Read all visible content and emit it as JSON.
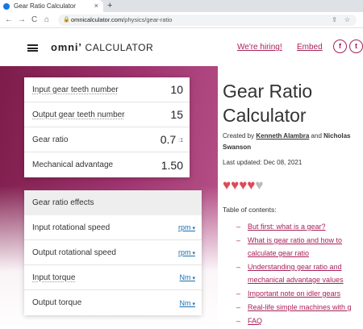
{
  "browser": {
    "tab_title": "Gear Ratio Calculator",
    "tab_close": "×",
    "new_tab": "+",
    "back": "←",
    "forward": "→",
    "reload": "C",
    "home": "⌂",
    "url_host": "omnicalculator.com",
    "url_path": "/physics/gear-ratio"
  },
  "header": {
    "logo_omni": "omni",
    "logo_calc": "CALCULATOR",
    "hiring": "We're hiring!",
    "embed": "Embed",
    "facebook": "f",
    "twitter": "t"
  },
  "calculator": {
    "rows": [
      {
        "label": "Input gear teeth number",
        "value": "10"
      },
      {
        "label": "Output gear teeth number",
        "value": "15"
      },
      {
        "label": "Gear ratio",
        "value": "0.7",
        "unit": ":1"
      },
      {
        "label": "Mechanical advantage",
        "value": "1.50"
      }
    ],
    "section_title": "Gear ratio effects",
    "effects": [
      {
        "label": "Input rotational speed",
        "unit": "rpm"
      },
      {
        "label": "Output rotational speed",
        "unit": "rpm"
      },
      {
        "label": "Input torque",
        "unit": "Nm"
      },
      {
        "label": "Output torque",
        "unit": "Nm"
      }
    ]
  },
  "article": {
    "title": "Gear Ratio Calculator",
    "created_by": "Created by",
    "author1": "Kenneth Alambra",
    "and": "and",
    "author2": "Nicholas Swanson",
    "updated": "Last updated: Dec 08, 2021",
    "rating": 4.5,
    "toc_title": "Table of contents:",
    "toc": [
      "But first: what is a gear?",
      "What is gear ratio and how to calculate gear ratio",
      "Understanding gear ratio and mechanical advantage values",
      "Important note on idler gears",
      "Real-life simple machines with g",
      "FAQ"
    ]
  },
  "colors": {
    "brand": "#a8215a",
    "link_blue": "#1a6fb0",
    "heart": "#e04a58"
  }
}
